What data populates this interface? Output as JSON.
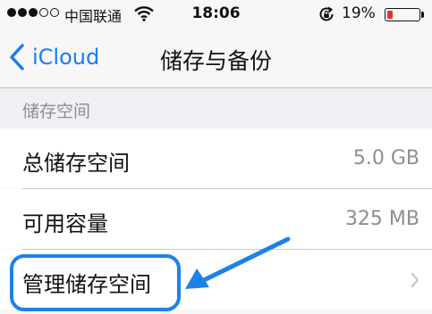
{
  "status_bar": {
    "carrier": "中国联通",
    "time": "18:06",
    "battery_percent": "19%",
    "battery_level": 0.19,
    "signal_bars_filled": 3,
    "signal_bars_total": 5
  },
  "nav": {
    "back_label": "iCloud",
    "title": "储存与备份"
  },
  "section": {
    "header": "储存空间",
    "rows": [
      {
        "label": "总储存空间",
        "value": "5.0 GB"
      },
      {
        "label": "可用容量",
        "value": "325 MB"
      },
      {
        "label": "管理储存空间"
      }
    ]
  },
  "colors": {
    "accent": "#1a7cf4",
    "annotation": "#1b82ea",
    "battery_low": "#e0342c"
  }
}
